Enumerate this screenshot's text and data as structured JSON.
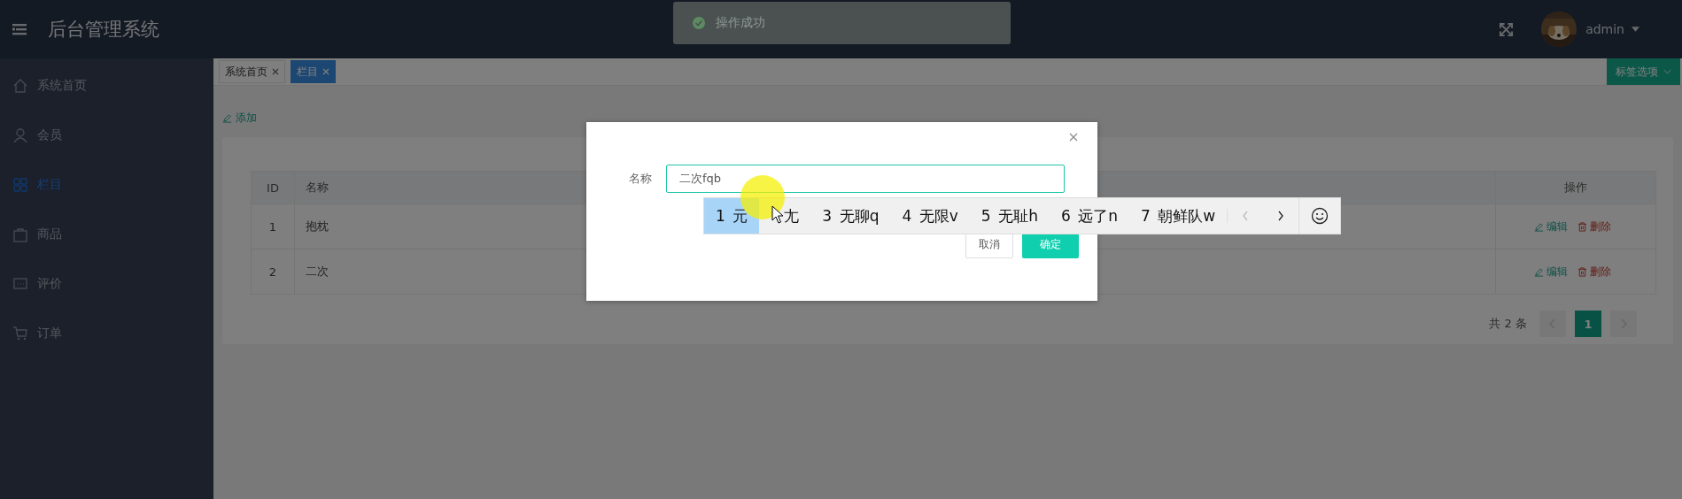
{
  "header": {
    "title": "后台管理系统",
    "user": "admin"
  },
  "toast": {
    "text": "操作成功"
  },
  "sidebar": {
    "items": [
      {
        "label": "系统首页",
        "selected": false
      },
      {
        "label": "会员",
        "selected": false
      },
      {
        "label": "栏目",
        "selected": true
      },
      {
        "label": "商品",
        "selected": false
      },
      {
        "label": "评价",
        "selected": false
      },
      {
        "label": "订单",
        "selected": false
      }
    ]
  },
  "tabs": {
    "items": [
      {
        "label": "系统首页",
        "selected": false
      },
      {
        "label": "栏目",
        "selected": true
      }
    ],
    "options": "标签选项"
  },
  "add_link": "添加",
  "table": {
    "columns": [
      "ID",
      "名称",
      "操作"
    ],
    "rows": [
      {
        "id": "1",
        "name": "抱枕",
        "actions": [
          {
            "kind": "edit",
            "label": "编辑"
          },
          {
            "kind": "delete",
            "label": "删除"
          }
        ]
      },
      {
        "id": "2",
        "name": "二次",
        "actions": [
          {
            "kind": "edit",
            "label": "编辑"
          },
          {
            "kind": "delete",
            "label": "删除"
          }
        ]
      }
    ]
  },
  "pagination": {
    "total": "共 2 条",
    "pages": [
      {
        "label": "1",
        "selected": true
      }
    ]
  },
  "modal": {
    "field_label": "名称",
    "value": "二次fqb",
    "buttons": [
      {
        "kind": "cancel",
        "label": "取消"
      },
      {
        "kind": "confirm",
        "label": "确定"
      }
    ]
  },
  "ime": {
    "candidates": [
      {
        "number": "1",
        "text": "元",
        "selected": true
      },
      {
        "text": "尢",
        "selected": false
      },
      {
        "number": "3",
        "text": "无聊q",
        "selected": false
      },
      {
        "number": "4",
        "text": "无限v",
        "selected": false
      },
      {
        "number": "5",
        "text": "无耻h",
        "selected": false
      },
      {
        "number": "6",
        "text": "远了n",
        "selected": false
      },
      {
        "number": "7",
        "text": "朝鲜队w",
        "selected": false
      }
    ]
  }
}
